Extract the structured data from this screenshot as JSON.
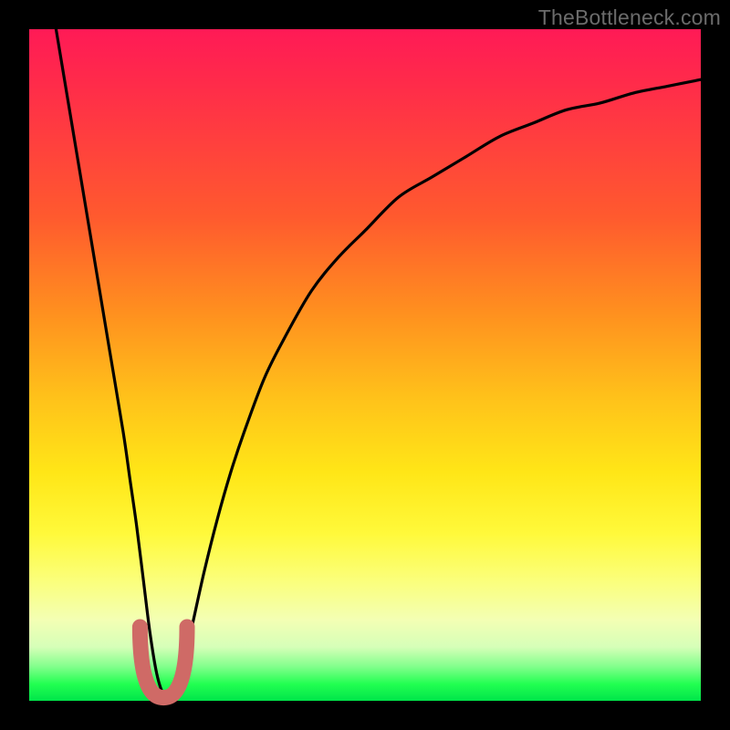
{
  "watermark": "TheBottleneck.com",
  "chart_data": {
    "type": "line",
    "title": "",
    "xlabel": "",
    "ylabel": "",
    "xlim": [
      0,
      100
    ],
    "ylim": [
      0,
      100
    ],
    "grid": false,
    "series": [
      {
        "name": "bottleneck-curve",
        "x": [
          4,
          6,
          8,
          10,
          12,
          14,
          15,
          16,
          17,
          18,
          19,
          20,
          21,
          22,
          23,
          24,
          26,
          28,
          30,
          32,
          35,
          38,
          42,
          46,
          50,
          55,
          60,
          65,
          70,
          75,
          80,
          85,
          90,
          95,
          100
        ],
        "values": [
          100,
          88,
          76,
          64,
          52,
          40,
          33,
          26,
          18,
          10,
          4,
          1,
          1,
          3,
          6,
          10,
          19,
          27,
          34,
          40,
          48,
          54,
          61,
          66,
          70,
          75,
          78,
          81,
          84,
          86,
          88,
          89,
          90.5,
          91.5,
          92.5
        ]
      }
    ],
    "annotations": [
      {
        "name": "trough-marker",
        "shape": "u",
        "color": "#cf6a66",
        "x_range": [
          16.5,
          23.5
        ],
        "y_range": [
          1,
          11
        ]
      }
    ],
    "colors": {
      "curve": "#000000",
      "marker": "#cf6a66",
      "gradient_top": "#ff1a56",
      "gradient_mid": "#ffe617",
      "gradient_bottom": "#00e54a",
      "frame": "#000000"
    }
  }
}
